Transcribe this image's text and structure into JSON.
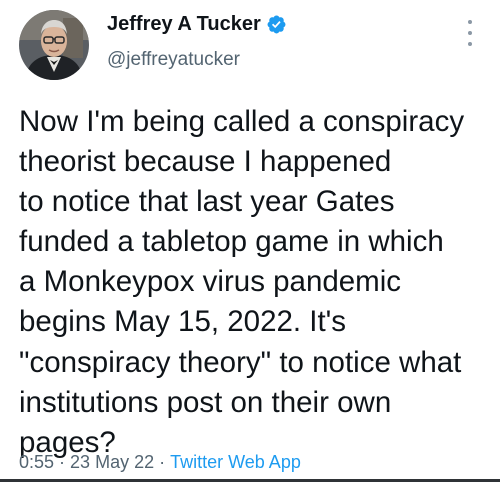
{
  "author": {
    "display_name": "Jeffrey A Tucker",
    "handle": "@jeffreyatucker",
    "verified": true,
    "verified_icon": "verified-badge-icon"
  },
  "tweet": {
    "lines": [
      "Now I'm being called a conspiracy",
      "theorist because I happened",
      "to notice that last year Gates",
      "funded a tabletop game in which",
      "a Monkeypox virus pandemic",
      "begins May 15, 2022. It's",
      "\"conspiracy theory\" to notice what",
      "institutions post on their own",
      "pages?"
    ]
  },
  "meta": {
    "time": "0:55",
    "date": "23 May 22",
    "separator": "·",
    "source": "Twitter Web App"
  },
  "colors": {
    "text": "#0f1419",
    "secondary": "#536471",
    "link": "#1d9bf0",
    "verified": "#1d9bf0"
  }
}
